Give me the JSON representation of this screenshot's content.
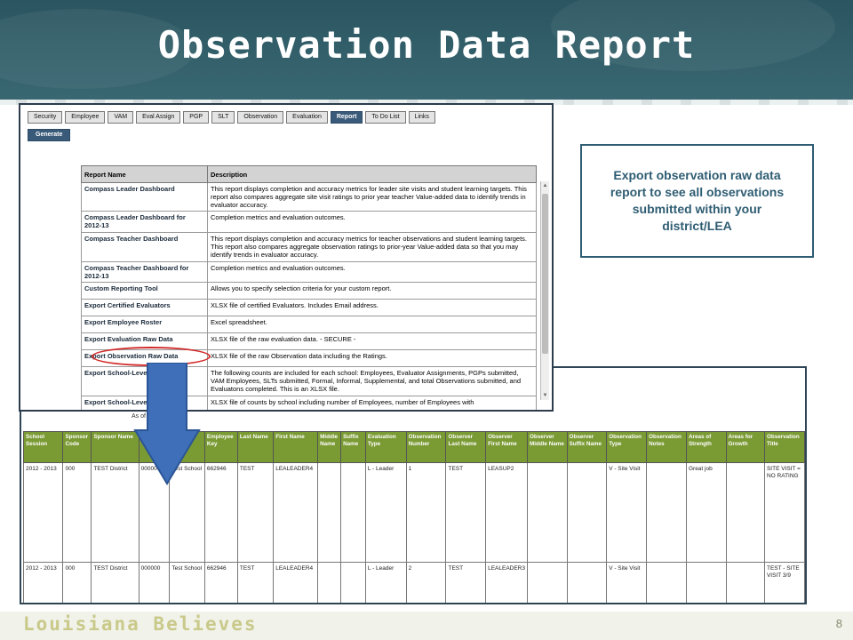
{
  "slide": {
    "title": "Observation Data Report",
    "footer_brand": "Louisiana Believes",
    "page_number": "8",
    "callout": "Export observation raw data report to see all observations submitted within your district/LEA"
  },
  "colors": {
    "header_bg": "#33606b",
    "nav_active": "#3a5a7a",
    "table_header_green": "#7a9a33",
    "highlight_red": "#d22a2a",
    "arrow_blue": "#3e6fb8"
  },
  "app": {
    "tabs": [
      {
        "label": "Security"
      },
      {
        "label": "Employee"
      },
      {
        "label": "VAM"
      },
      {
        "label": "Eval Assign"
      },
      {
        "label": "PGP"
      },
      {
        "label": "SLT"
      },
      {
        "label": "Observation"
      },
      {
        "label": "Evaluation"
      },
      {
        "label": "Report",
        "active": true
      },
      {
        "label": "To Do List"
      },
      {
        "label": "Links"
      }
    ],
    "generate_label": "Generate",
    "report_table": {
      "headers": [
        "Report Name",
        "Description"
      ],
      "rows": [
        {
          "name": "Compass Leader Dashboard",
          "desc": "This report displays completion and accuracy metrics for leader site visits and student learning targets. This report also compares aggregate site visit ratings to prior year teacher Value-added data to identify trends in evaluator accuracy."
        },
        {
          "name": "Compass Leader Dashboard for 2012-13",
          "desc": "Completion metrics and evaluation outcomes."
        },
        {
          "name": "Compass Teacher Dashboard",
          "desc": "This report displays completion and accuracy metrics for teacher observations and student learning targets. This report also compares aggregate observation ratings to prior-year Value-added data so that you may identify trends in evaluator accuracy."
        },
        {
          "name": "Compass Teacher Dashboard for 2012-13",
          "desc": "Completion metrics and evaluation outcomes."
        },
        {
          "name": "Custom Reporting Tool",
          "desc": "Allows you to specify selection criteria for your custom report."
        },
        {
          "name": "Export Certified Evaluators",
          "desc": "XLSX file of certified Evaluators. Includes Email address."
        },
        {
          "name": "Export Employee Roster",
          "desc": "Excel spreadsheet."
        },
        {
          "name": "Export Evaluation Raw Data",
          "desc": "XLSX file of the raw evaluation data. - SECURE -"
        },
        {
          "name": "Export Observation Raw Data",
          "desc": "XLSX file of the raw Observation data including the Ratings."
        },
        {
          "name": "Export School-Level Data",
          "desc": "The following counts are included for each school: Employees, Evaluator Assignments, PGPs submitted, VAM Employees, SLTs submitted, Formal, Informal, Supplemental, and total Observations submitted, and Evaluatons completed. This is an XLSX file."
        },
        {
          "name": "Export School-Level",
          "desc": "XLSX file of counts by school including number of Employees, number of Employees with"
        }
      ]
    }
  },
  "raw_data": {
    "as_of": "As of 9",
    "headers": [
      "School Session",
      "Sponsor Code",
      "Sponsor Name",
      "",
      "",
      "Employee Key",
      "Last Name",
      "First Name",
      "Middle Name",
      "Suffix Name",
      "Evaluation Type",
      "Observation Number",
      "Observer Last Name",
      "Observer First Name",
      "Observer Middle Name",
      "Observer Suffix Name",
      "Observation Type",
      "Observation Notes",
      "Areas of Strength",
      "Areas for Growth",
      "Observation Title"
    ],
    "rows": [
      [
        "2012 - 2013",
        "000",
        "TEST District",
        "000000",
        "Test School",
        "662946",
        "TEST",
        "LEALEADER4",
        "",
        "",
        "L - Leader",
        "1",
        "TEST",
        "LEASUP2",
        "",
        "",
        "V - Site Visit",
        "",
        "Great job",
        "",
        "SITE VISIT = NO RATING"
      ],
      [
        "2012 - 2013",
        "000",
        "TEST District",
        "000000",
        "Test School",
        "662946",
        "TEST",
        "LEALEADER4",
        "",
        "",
        "L - Leader",
        "2",
        "TEST",
        "LEALEADER3",
        "",
        "",
        "V - Site Visit",
        "",
        "",
        "",
        "TEST - SITE VISIT 3/9"
      ]
    ]
  }
}
